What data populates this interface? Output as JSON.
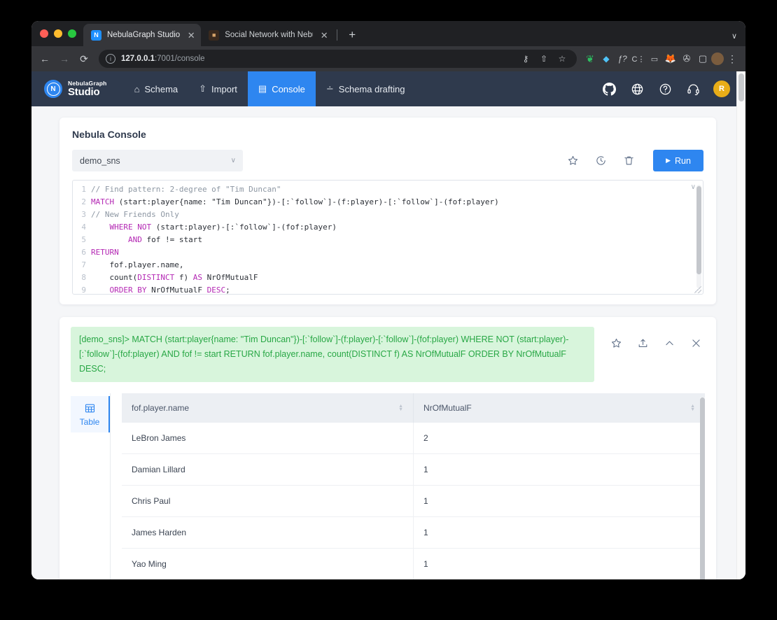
{
  "browser": {
    "tabs": [
      {
        "label": "NebulaGraph Studio",
        "favicon": "nebula-icon",
        "active": true,
        "close": "✕"
      },
      {
        "label": "Social Network with NebulaGra",
        "favicon": "doc-icon",
        "active": false,
        "close": "✕"
      }
    ],
    "new_tab_label": "+",
    "window_expand": "∨",
    "nav": {
      "back": "←",
      "forward": "→",
      "reload": "⟳"
    },
    "omnibox": {
      "info_icon": "ⓘ",
      "url_host": "127.0.0.1",
      "url_path": ":7001/console",
      "key_icon": "⚷",
      "share_icon": "⇧",
      "bookmark_icon": "☆"
    },
    "extensions": [
      {
        "name": "evernote-icon",
        "glyph": "❦"
      },
      {
        "name": "diamond-icon",
        "glyph": "◆"
      },
      {
        "name": "fx-icon",
        "glyph": "ƒ?"
      },
      {
        "name": "ci-icon",
        "glyph": "C⋮"
      },
      {
        "name": "mail-icon",
        "glyph": "▭"
      },
      {
        "name": "firefox-icon",
        "glyph": "🦊"
      },
      {
        "name": "puzzle-icon",
        "glyph": "✇"
      },
      {
        "name": "side-panel-icon",
        "glyph": "▢"
      },
      {
        "name": "profile-avatar",
        "glyph": "●"
      },
      {
        "name": "kebab-menu-icon",
        "glyph": "⋮"
      }
    ]
  },
  "app": {
    "brand": {
      "line1": "NebulaGraph",
      "line2": "Studio",
      "mark": "N"
    },
    "nav_items": [
      {
        "label": "Schema",
        "icon": "schema-icon",
        "active": false
      },
      {
        "label": "Import",
        "icon": "import-icon",
        "active": false
      },
      {
        "label": "Console",
        "icon": "console-icon",
        "active": true
      },
      {
        "label": "Schema drafting",
        "icon": "drafting-icon",
        "active": false
      }
    ],
    "nav_right": [
      {
        "name": "github-icon"
      },
      {
        "name": "language-globe-icon"
      },
      {
        "name": "help-icon"
      },
      {
        "name": "support-headset-icon"
      }
    ],
    "avatar_letter": "R",
    "accent_color": "#2e86f0",
    "navbar_color": "#2f3a4d"
  },
  "console": {
    "title": "Nebula Console",
    "space_selected": "demo_sns",
    "space_chevron": "∨",
    "actions": [
      {
        "name": "favorite-star-icon",
        "glyph": "☆"
      },
      {
        "name": "history-clock-icon",
        "glyph": "◔"
      },
      {
        "name": "clear-trash-icon",
        "glyph": "🗑"
      }
    ],
    "run_label": "Run",
    "run_icon": "▶",
    "collapse_icon": "∨",
    "editor_lines": [
      {
        "n": "1",
        "tokens": [
          {
            "t": "// Find pattern: 2-degree of \"Tim Duncan\"",
            "c": "cm"
          }
        ]
      },
      {
        "n": "2",
        "tokens": [
          {
            "t": "MATCH",
            "c": "kw"
          },
          {
            "t": " (start:player{name: \"Tim Duncan\"})-[:`follow`]-(f:player)-[:`follow`]-(fof:player)",
            "c": "ctext"
          }
        ]
      },
      {
        "n": "3",
        "tokens": [
          {
            "t": "// New Friends Only",
            "c": "cm"
          }
        ]
      },
      {
        "n": "4",
        "tokens": [
          {
            "t": "    ",
            "c": "ctext"
          },
          {
            "t": "WHERE NOT",
            "c": "kw"
          },
          {
            "t": " (start:player)-[:`follow`]-(fof:player)",
            "c": "ctext"
          }
        ]
      },
      {
        "n": "5",
        "tokens": [
          {
            "t": "        ",
            "c": "ctext"
          },
          {
            "t": "AND",
            "c": "kw"
          },
          {
            "t": " fof != start",
            "c": "ctext"
          }
        ]
      },
      {
        "n": "6",
        "tokens": [
          {
            "t": "RETURN",
            "c": "kw"
          }
        ]
      },
      {
        "n": "7",
        "tokens": [
          {
            "t": "    fof.player.name,",
            "c": "ctext"
          }
        ]
      },
      {
        "n": "8",
        "tokens": [
          {
            "t": "    count(",
            "c": "ctext"
          },
          {
            "t": "DISTINCT",
            "c": "kw"
          },
          {
            "t": " f) ",
            "c": "ctext"
          },
          {
            "t": "AS",
            "c": "kw"
          },
          {
            "t": " NrOfMutualF",
            "c": "ctext"
          }
        ]
      },
      {
        "n": "9",
        "tokens": [
          {
            "t": "    ",
            "c": "ctext"
          },
          {
            "t": "ORDER BY",
            "c": "kw"
          },
          {
            "t": " NrOfMutualF ",
            "c": "ctext"
          },
          {
            "t": "DESC",
            "c": "kw"
          },
          {
            "t": ";",
            "c": "ctext"
          }
        ]
      }
    ]
  },
  "result": {
    "gql": "[demo_sns]> MATCH (start:player{name: \"Tim Duncan\"})-[:`follow`]-(f:player)-[:`follow`]-(fof:player) WHERE NOT (start:player)-[:`follow`]-(fof:player) AND fof != start RETURN fof.player.name, count(DISTINCT f) AS NrOfMutualF ORDER BY NrOfMutualF DESC;",
    "gql_bg_color": "#d8f5dc",
    "gql_text_color": "#28a745",
    "actions": [
      {
        "name": "favorite-star-icon",
        "glyph": "☆"
      },
      {
        "name": "export-icon",
        "glyph": "⇧"
      },
      {
        "name": "collapse-up-icon",
        "glyph": "∧"
      },
      {
        "name": "close-icon",
        "glyph": "✕"
      }
    ],
    "view_tabs": [
      {
        "label": "Table",
        "icon": "table-grid-icon",
        "active": true
      }
    ],
    "table": {
      "columns": [
        "fof.player.name",
        "NrOfMutualF"
      ],
      "rows": [
        [
          "LeBron James",
          "2"
        ],
        [
          "Damian Lillard",
          "1"
        ],
        [
          "Chris Paul",
          "1"
        ],
        [
          "James Harden",
          "1"
        ],
        [
          "Yao Ming",
          "1"
        ]
      ]
    }
  }
}
